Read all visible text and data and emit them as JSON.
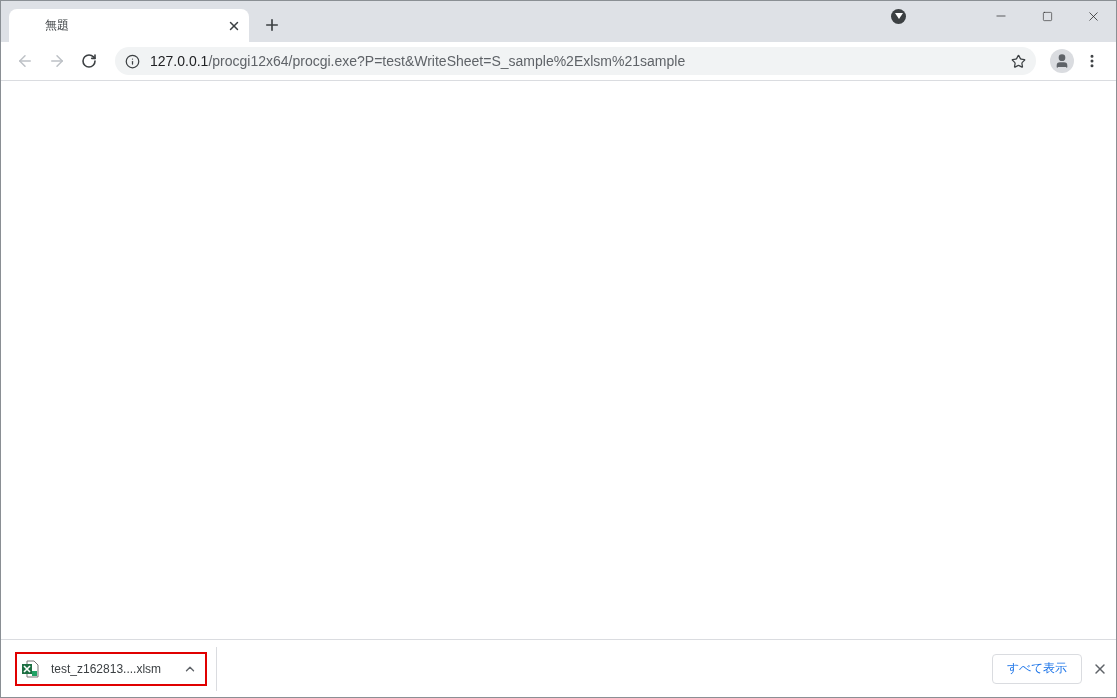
{
  "tab": {
    "title": "無題",
    "selected": true
  },
  "address_bar": {
    "host": "127.0.0.1",
    "path": "/procgi12x64/procgi.exe?P=test&WriteSheet=S_sample%2Exlsm%21sample"
  },
  "download_shelf": {
    "items": [
      {
        "filename": "test_z162813....xlsm",
        "highlighted": true
      }
    ],
    "show_all": "すべて表示"
  }
}
